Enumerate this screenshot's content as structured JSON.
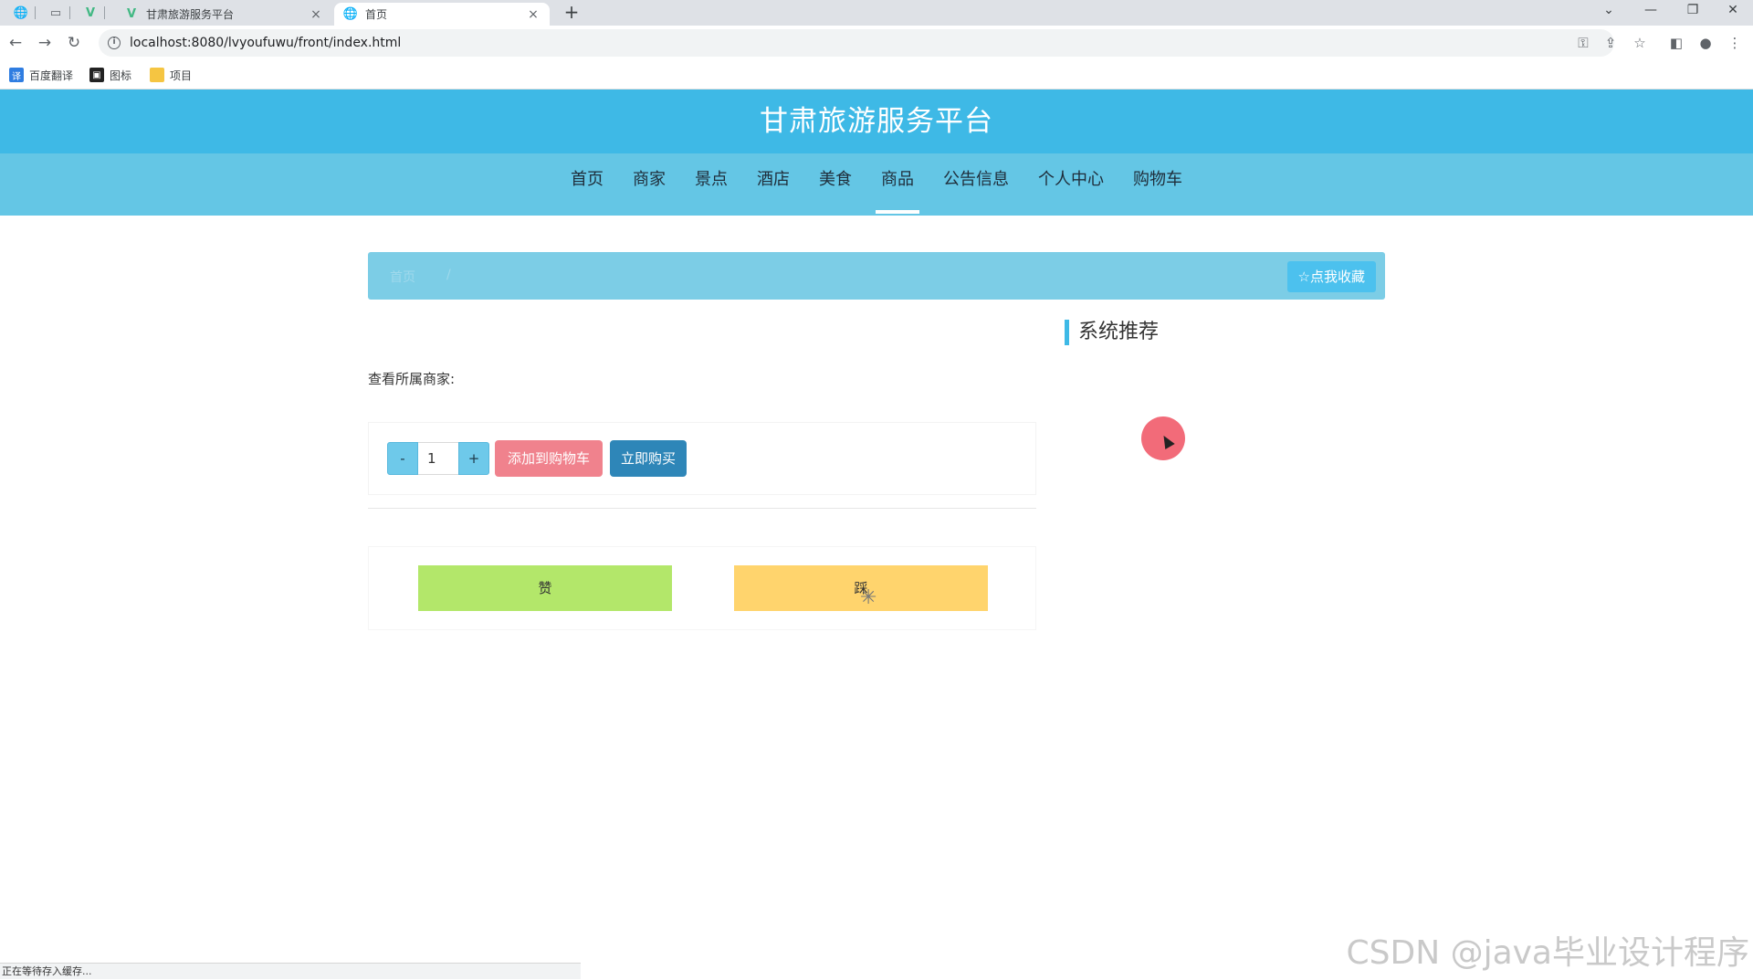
{
  "browser": {
    "tabs": [
      {
        "title": "甘肃旅游服务平台",
        "favicon": "vue-logo-icon"
      },
      {
        "title": "首页",
        "favicon": "globe-icon",
        "active": true
      }
    ],
    "address": "localhost:8080/lvyoufuwu/front/index.html",
    "bookmarks": [
      {
        "label": "百度翻译",
        "icon": "translate-icon",
        "color": "#2f7de1"
      },
      {
        "label": "图标",
        "icon": "image-icon",
        "color": "#222222"
      },
      {
        "label": "项目",
        "icon": "folder-icon",
        "color": "#f5c542"
      }
    ],
    "status_text": "正在等待存入缓存..."
  },
  "site": {
    "title": "甘肃旅游服务平台",
    "nav": [
      {
        "label": "首页"
      },
      {
        "label": "商家"
      },
      {
        "label": "景点"
      },
      {
        "label": "酒店"
      },
      {
        "label": "美食"
      },
      {
        "label": "商品",
        "active": true
      },
      {
        "label": "公告信息"
      },
      {
        "label": "个人中心"
      },
      {
        "label": "购物车"
      }
    ]
  },
  "breadcrumb": {
    "home": "首页",
    "separator": "/"
  },
  "favorite_button": {
    "label": "点我收藏",
    "icon": "star-icon"
  },
  "recommend": {
    "title": "系统推荐"
  },
  "product": {
    "merchant_label": "查看所属商家:",
    "quantity": {
      "minus": "-",
      "value": "1",
      "plus": "+"
    },
    "add_to_cart": "添加到购物车",
    "buy_now": "立即购买"
  },
  "vote": {
    "like": "赞",
    "dislike": "踩"
  },
  "watermark": "CSDN @java毕业设计程序",
  "colors": {
    "header": "#3eb9e6",
    "navbar": "#64c6e5",
    "add_to_cart": "#f0828d",
    "buy_now": "#2e86b8",
    "like": "#b3e76a",
    "dislike": "#ffd46d"
  }
}
